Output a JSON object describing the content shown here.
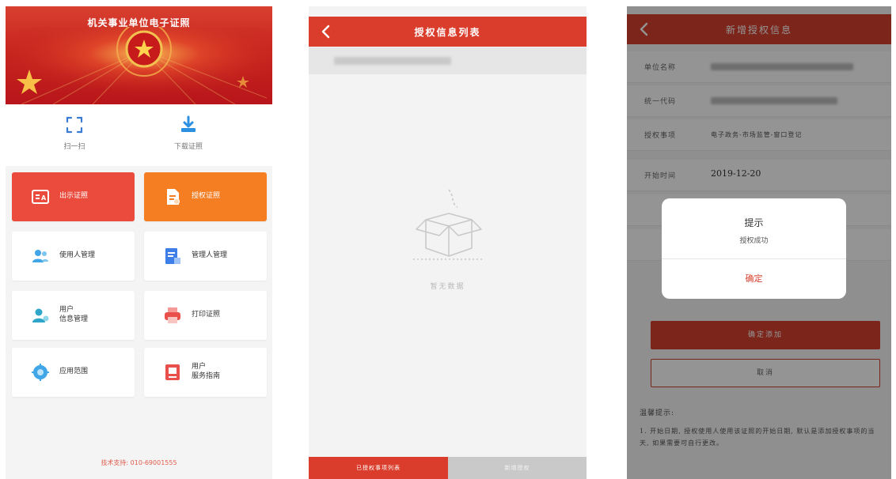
{
  "phone1": {
    "header": {
      "title": "机关事业单位电子证照"
    },
    "actions": [
      {
        "label": "扫一扫",
        "icon": "scan-icon"
      },
      {
        "label": "下载证照",
        "icon": "download-icon"
      }
    ],
    "cards": [
      {
        "label": "出示证照",
        "icon": "id-card-icon",
        "style": "red"
      },
      {
        "label": "授权证照",
        "icon": "authorize-doc-icon",
        "style": "orange"
      },
      {
        "label": "使用人管理",
        "icon": "users-icon",
        "style": "white"
      },
      {
        "label": "管理人管理",
        "icon": "manager-doc-icon",
        "style": "white"
      },
      {
        "label": "用户\n信息管理",
        "icon": "user-info-icon",
        "style": "white"
      },
      {
        "label": "打印证照",
        "icon": "printer-icon",
        "style": "white"
      },
      {
        "label": "应用范围",
        "icon": "scope-icon",
        "style": "white"
      },
      {
        "label": "用户\n服务指南",
        "icon": "guide-icon",
        "style": "white"
      }
    ],
    "footer": "技术支持: 010-69001555"
  },
  "phone2": {
    "header": {
      "title": "授权信息列表",
      "back_icon": "chevron-left-icon"
    },
    "empty_text": "暂无数据",
    "tabs": {
      "list": "已授权事项列表",
      "new": "新增授权"
    }
  },
  "phone3": {
    "header": {
      "title": "新增授权信息",
      "back_icon": "chevron-left-icon"
    },
    "form": {
      "unit_name_label": "单位名称",
      "unified_code_label": "统一代码",
      "auth_item_label": "授权事项",
      "auth_item_value": "电子政务-市场监管-窗口登记",
      "start_time_label": "开始时间",
      "start_time_value": "2019-12-20"
    },
    "confirm_add": "确定添加",
    "cancel": "取消",
    "tips_title": "温馨提示:",
    "tips_body": "1. 开始日期, 授权使用人使用该证照的开始日期, 默认是添加授权事项的当天, 如果需要可自行更改。",
    "dialog": {
      "title": "提示",
      "message": "授权成功",
      "ok": "确定"
    }
  },
  "colors": {
    "primary_red": "#db3d2c",
    "accent_orange": "#f57d22"
  }
}
